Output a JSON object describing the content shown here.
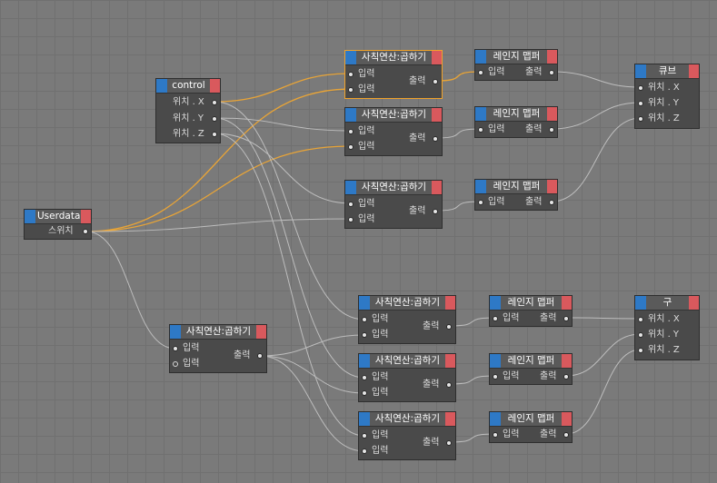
{
  "nodes": {
    "control": {
      "title": "control",
      "outputs": [
        "위치 . X",
        "위치 . Y",
        "위치 . Z"
      ]
    },
    "userdata": {
      "title": "Userdata",
      "outputs": [
        "스위치"
      ]
    },
    "cube": {
      "title": "큐브",
      "inputs": [
        "위치 . X",
        "위치 . Y",
        "위치 . Z"
      ]
    },
    "sphere": {
      "title": "구",
      "inputs": [
        "위치 . X",
        "위치 . Y",
        "위치 . Z"
      ]
    },
    "math_node": {
      "title": "사칙연산:곱하기",
      "input_label": "입력",
      "output_label": "출력"
    },
    "range_mapper": {
      "title": "레인지 맵퍼",
      "input_label": "입력",
      "output_label": "출력"
    }
  },
  "colors": {
    "header_accent": "#2e79c6",
    "header_close": "#d9595d",
    "selected_outline": "#f0a22a",
    "active_wire": "#e8a437",
    "inactive_wire": "#bdbdbd"
  }
}
